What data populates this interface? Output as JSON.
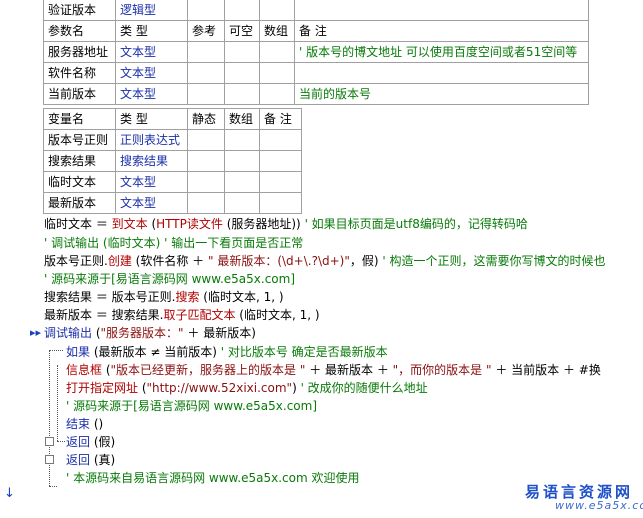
{
  "table1": {
    "top_row": [
      "验证版本",
      "逻辑型"
    ],
    "headers": [
      "参数名",
      "类 型",
      "参考",
      "可空",
      "数组",
      "备 注"
    ],
    "rows": [
      [
        "服务器地址",
        "文本型",
        "",
        "",
        "",
        "' 版本号的博文地址 可以使用百度空间或者51空间等"
      ],
      [
        "软件名称",
        "文本型",
        "",
        "",
        "",
        ""
      ],
      [
        "当前版本",
        "文本型",
        "",
        "",
        "",
        "当前的版本号"
      ]
    ]
  },
  "table2": {
    "headers": [
      "变量名",
      "类 型",
      "静态",
      "数组",
      "备 注"
    ],
    "rows": [
      [
        "版本号正则",
        "正则表达式",
        "",
        "",
        ""
      ],
      [
        "搜索结果",
        "搜索结果",
        "",
        "",
        ""
      ],
      [
        "临时文本",
        "文本型",
        "",
        "",
        ""
      ],
      [
        "最新版本",
        "文本型",
        "",
        "",
        ""
      ]
    ]
  },
  "code": {
    "l1": {
      "a": "临时文本 ＝ ",
      "b": "到文本",
      "c": " (",
      "d": "HTTP读文件",
      "e": " (服务器地址)) ",
      "f": "' 如果目标页面是utf8编码的，记得转码哈"
    },
    "l2": {
      "a": "' 调试输出 (临时文本)  ' 输出一下看页面是否正常"
    },
    "l3": {
      "a": "版本号正则.",
      "b": "创建",
      "c": " (软件名称 ＋ ",
      "d": "\" 最新版本：(\\d+\\.?\\d+)\"",
      "e": "，假)  ",
      "f": "' 构造一个正则，这需要你写博文的时候也"
    },
    "l4": {
      "a": "' 源码来源于[易语言源码网 www.e5a5x.com]"
    },
    "l5": {
      "a": "搜索结果 ＝ 版本号正则.",
      "b": "搜索",
      "c": " (临时文本, 1, )"
    },
    "l6": {
      "a": "最新版本 ＝ 搜索结果.",
      "b": "取子匹配文本",
      "c": " (临时文本, 1, )"
    },
    "l7": {
      "a": "调试输出",
      "b": " (",
      "c": "\"服务器版本：\"",
      "d": " ＋ 最新版本)"
    },
    "l8": {
      "a": "如果",
      "b": " (最新版本 ≠ 当前版本)  ",
      "c": "' 对比版本号 确定是否最新版本"
    },
    "l9": {
      "a": "信息框",
      "b": " (",
      "c": "\"版本已经更新，服务器上的版本是 \"",
      "d": " ＋ 最新版本 ＋ ",
      "e": "\"，而你的版本是 \"",
      "f": " ＋ 当前版本 ＋ #换"
    },
    "l10": {
      "a": "打开指定网址",
      "b": " (",
      "c": "\"http://www.52xixi.com\"",
      "d": ")  ",
      "e": "' 改成你的随便什么地址"
    },
    "l11": {
      "a": "' 源码来源于[易语言源码网 www.e5a5x.com]"
    },
    "l12": {
      "a": "结束",
      "b": " ()"
    },
    "l13": {
      "a": "返回",
      "b": " (假)"
    },
    "l14": {
      "a": "返回",
      "b": " (真)"
    },
    "l15": {
      "a": "' 本源码来自易语言源码网 www.e5a5x.com  欢迎使用"
    }
  },
  "gutter": {
    "arrow_mark": "▸▸",
    "down_mark": "↓"
  },
  "watermark": {
    "title": "易语言资源网",
    "url": "www.e5a5x.com"
  }
}
